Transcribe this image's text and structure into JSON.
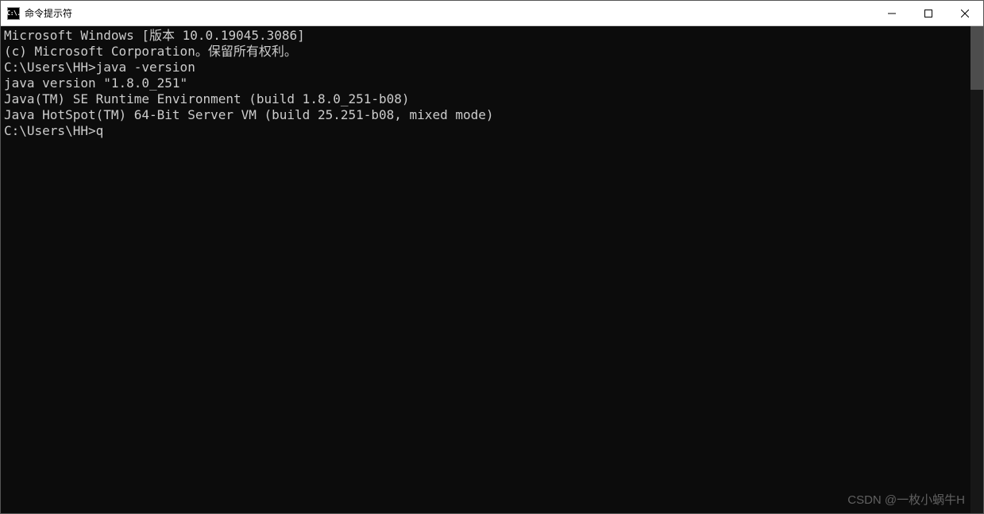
{
  "titlebar": {
    "icon_text": "C:\\.",
    "title": "命令提示符"
  },
  "terminal": {
    "lines": [
      "Microsoft Windows [版本 10.0.19045.3086]",
      "(c) Microsoft Corporation。保留所有权利。",
      "",
      "C:\\Users\\HH>java -version",
      "java version \"1.8.0_251\"",
      "Java(TM) SE Runtime Environment (build 1.8.0_251-b08)",
      "Java HotSpot(TM) 64-Bit Server VM (build 25.251-b08, mixed mode)",
      "",
      "C:\\Users\\HH>q"
    ]
  },
  "watermark": "CSDN @一枚小蜗牛H"
}
